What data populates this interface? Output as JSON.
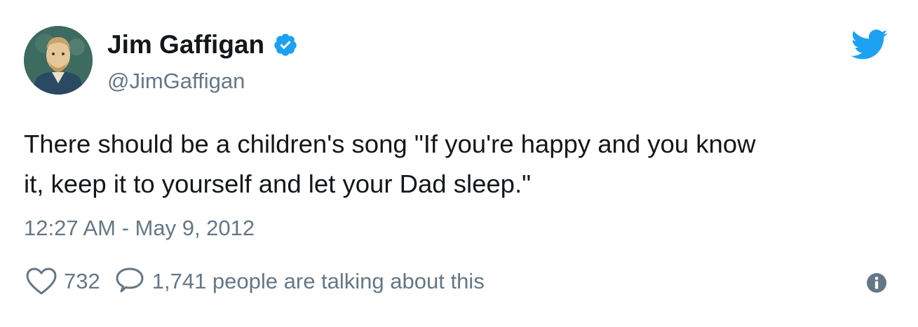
{
  "author": {
    "display_name": "Jim Gaffigan",
    "handle": "@JimGaffigan",
    "verified": true,
    "avatar_icon": "portrait-avatar"
  },
  "tweet": {
    "text": "There should be a children's song \"If you're happy and you know\nit, keep it to yourself and let your Dad sleep.\"",
    "timestamp": "12:27 AM - May 9, 2012"
  },
  "engagement": {
    "likes": "732",
    "conversation": "1,741 people are talking about this"
  },
  "icons": {
    "brand": "twitter-bird-icon",
    "verified": "verified-badge-icon",
    "like": "heart-icon",
    "reply": "speech-bubble-icon",
    "info": "info-icon"
  },
  "colors": {
    "brand_blue": "#1da1f2",
    "text_primary": "#14171a",
    "text_secondary": "#657786"
  }
}
